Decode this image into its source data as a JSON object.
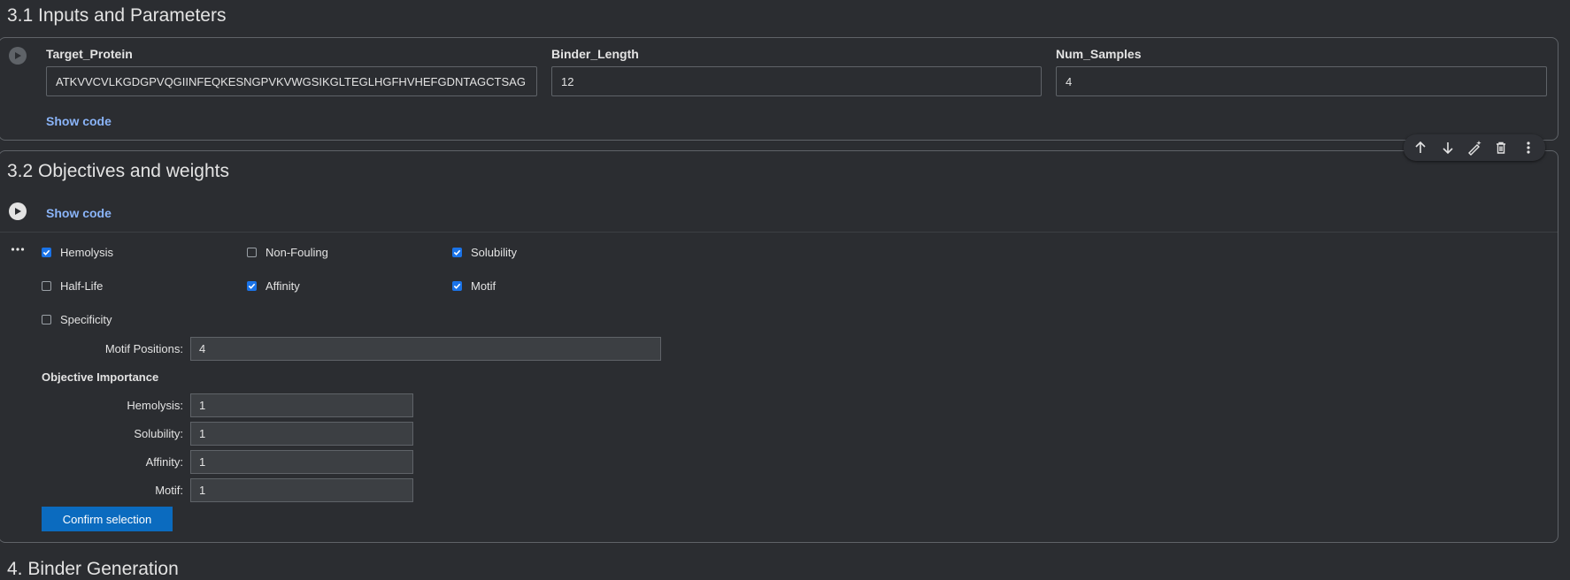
{
  "section_31": {
    "heading": "3.1 Inputs and Parameters",
    "params": [
      {
        "label": "Target_Protein",
        "value": "ATKVVCVLKGDGPVQGIINFEQKESNGPVKVWGSIKGLTEGLHGFHVHEFGDNTAGCTSAG"
      },
      {
        "label": "Binder_Length",
        "value": "12"
      },
      {
        "label": "Num_Samples",
        "value": "4"
      }
    ],
    "show_code": "Show code"
  },
  "section_32": {
    "heading": "3.2 Objectives and weights",
    "show_code": "Show code"
  },
  "cell_toolbar": {
    "icons": [
      "arrow-up-icon",
      "arrow-down-icon",
      "edit-magic-icon",
      "delete-icon",
      "more-vert-icon"
    ]
  },
  "objectives": {
    "checkboxes": [
      {
        "label": "Hemolysis",
        "checked": true
      },
      {
        "label": "Non-Fouling",
        "checked": false
      },
      {
        "label": "Solubility",
        "checked": true
      },
      {
        "label": "Half-Life",
        "checked": false
      },
      {
        "label": "Affinity",
        "checked": true
      },
      {
        "label": "Motif",
        "checked": true
      },
      {
        "label": "Specificity",
        "checked": false
      }
    ],
    "motif_positions": {
      "label": "Motif Positions:",
      "value": "4"
    },
    "importance_heading": "Objective Importance",
    "importance": [
      {
        "label": "Hemolysis:",
        "value": "1"
      },
      {
        "label": "Solubility:",
        "value": "1"
      },
      {
        "label": "Affinity:",
        "value": "1"
      },
      {
        "label": "Motif:",
        "value": "1"
      }
    ],
    "confirm_label": "Confirm selection"
  },
  "next_section": {
    "heading": "4. Binder Generation"
  },
  "colors": {
    "background": "#2b2d31",
    "link": "#8ab4f8",
    "checkbox_on": "#1a73e8",
    "button": "#0b6bbf"
  }
}
